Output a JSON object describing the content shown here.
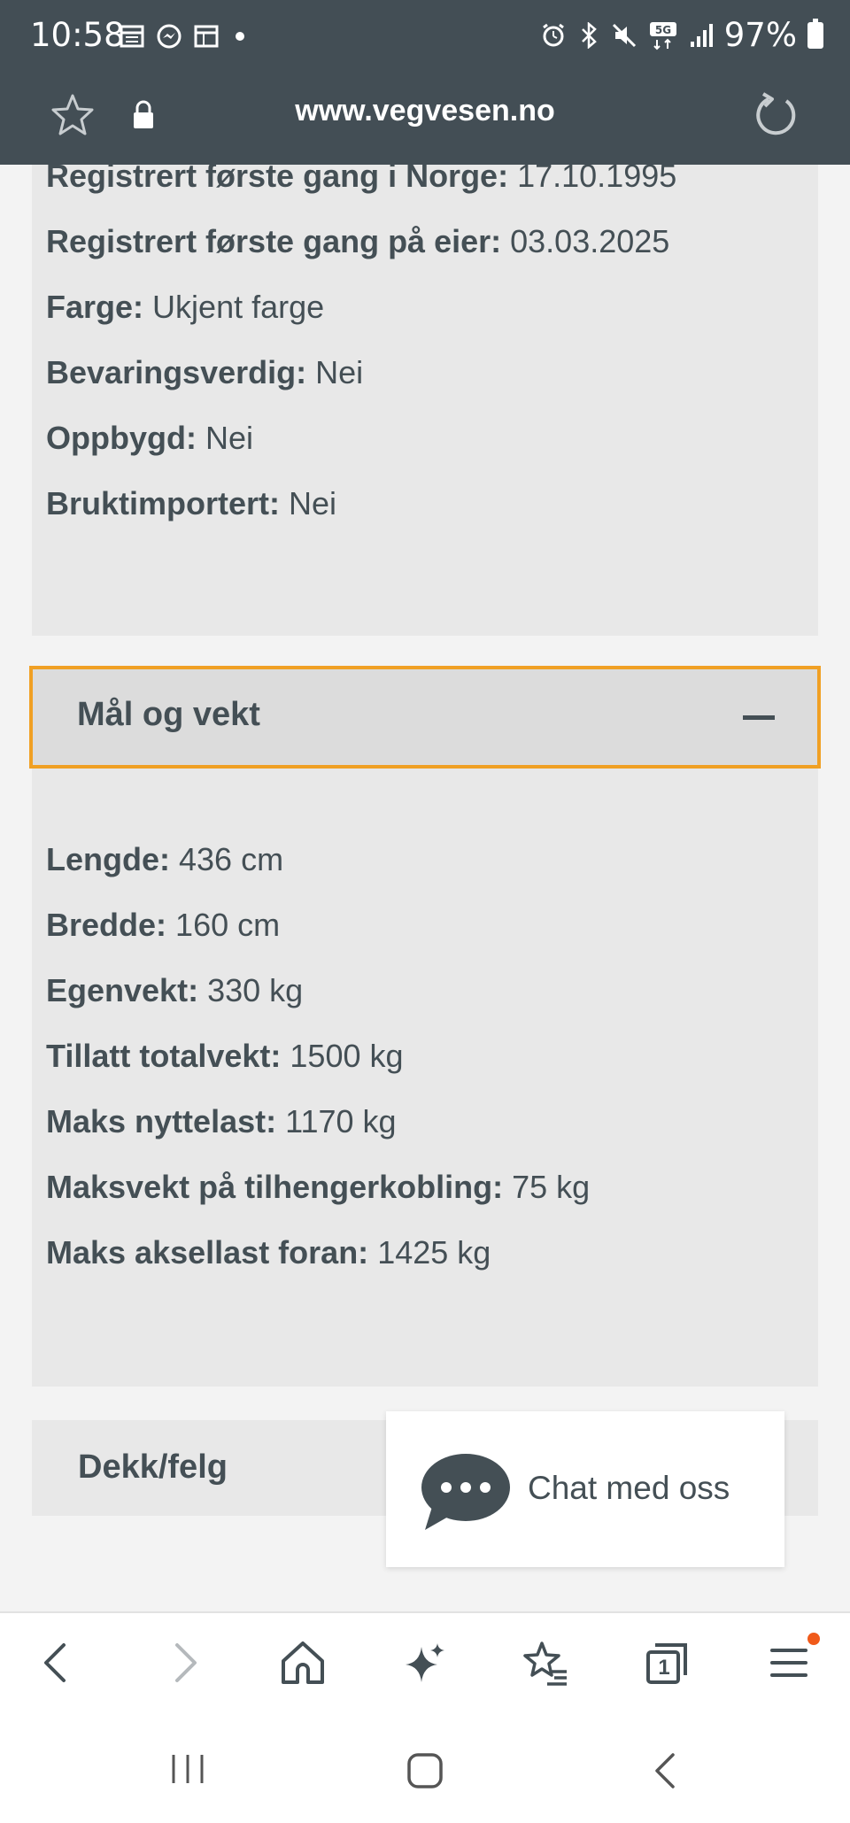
{
  "status_bar": {
    "time": "10:58",
    "battery": "97%",
    "left_icons": [
      "calendar-icon",
      "messenger-icon",
      "calendar-icon",
      "dot-icon"
    ],
    "right_icons": [
      "alarm-icon",
      "bluetooth-icon",
      "mute-icon",
      "5g-icon",
      "signal-icon",
      "battery-icon"
    ]
  },
  "browser": {
    "url": "www.vegvesen.no"
  },
  "registration": {
    "rows": [
      {
        "label": "Registrert første gang i Norge:",
        "value": "17.10.1995"
      },
      {
        "label": "Registrert første gang på eier:",
        "value": "03.03.2025"
      },
      {
        "label": "Farge:",
        "value": "Ukjent farge"
      },
      {
        "label": "Bevaringsverdig:",
        "value": "Nei"
      },
      {
        "label": "Oppbygd:",
        "value": "Nei"
      },
      {
        "label": "Bruktimportert:",
        "value": "Nei"
      }
    ]
  },
  "dimensions_section": {
    "title": "Mål og vekt",
    "rows": [
      {
        "label": "Lengde:",
        "value": "436 cm"
      },
      {
        "label": "Bredde:",
        "value": "160 cm"
      },
      {
        "label": "Egenvekt:",
        "value": "330 kg"
      },
      {
        "label": "Tillatt totalvekt:",
        "value": "1500 kg"
      },
      {
        "label": "Maks nyttelast:",
        "value": "1170 kg"
      },
      {
        "label": "Maksvekt på tilhengerkobling:",
        "value": "75 kg"
      },
      {
        "label": "Maks aksellast foran:",
        "value": "1425 kg"
      }
    ]
  },
  "tires_section": {
    "title": "Dekk/felg"
  },
  "chat": {
    "label": "Chat med oss"
  },
  "bottom_nav": {
    "tab_count": "1"
  },
  "colors": {
    "header_bg": "#434e55",
    "focus_border": "#f0a024",
    "notification_dot": "#f05a1a"
  }
}
